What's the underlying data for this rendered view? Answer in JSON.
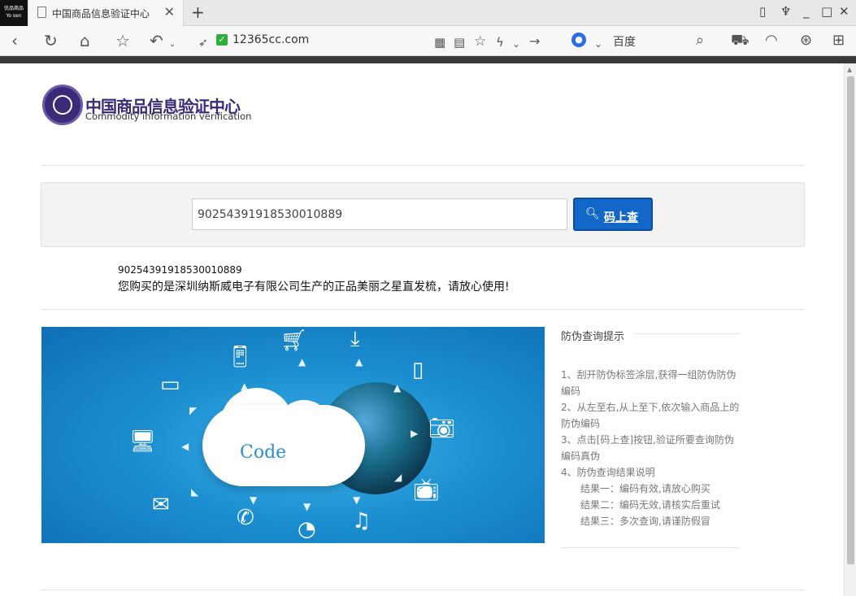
{
  "browser": {
    "app_badge": [
      "优品商品",
      "Yo sen"
    ],
    "tab_title": "中国商品信息验证中心",
    "address": "12365cc.com",
    "search_engine": "百度"
  },
  "site": {
    "logo_cn": "中国商品信息验证中心",
    "logo_en": "Commodity information verification"
  },
  "search": {
    "input_value": "90254391918530010889",
    "button_label": "码上查"
  },
  "result": {
    "code": "90254391918530010889",
    "message": "您购买的是深圳纳斯威电子有限公司生产的正品美丽之星直发梳，请放心使用!"
  },
  "banner": {
    "text": "Code"
  },
  "tips": {
    "title": "防伪查询提示",
    "items": [
      "1、刮开防伪标签涂层,获得一组防伪防伪编码",
      "2、从左至右,从上至下,依次输入商品上的防伪编码",
      "3、点击[码上查]按钮,验证所要查询防伪编码真伪",
      "4、防伪查询结果说明"
    ],
    "results": [
      "结果一：编码有效,请放心购买",
      "结果二：编码无效,请核实后重试",
      "结果三：多次查询,请谨防假冒"
    ]
  }
}
